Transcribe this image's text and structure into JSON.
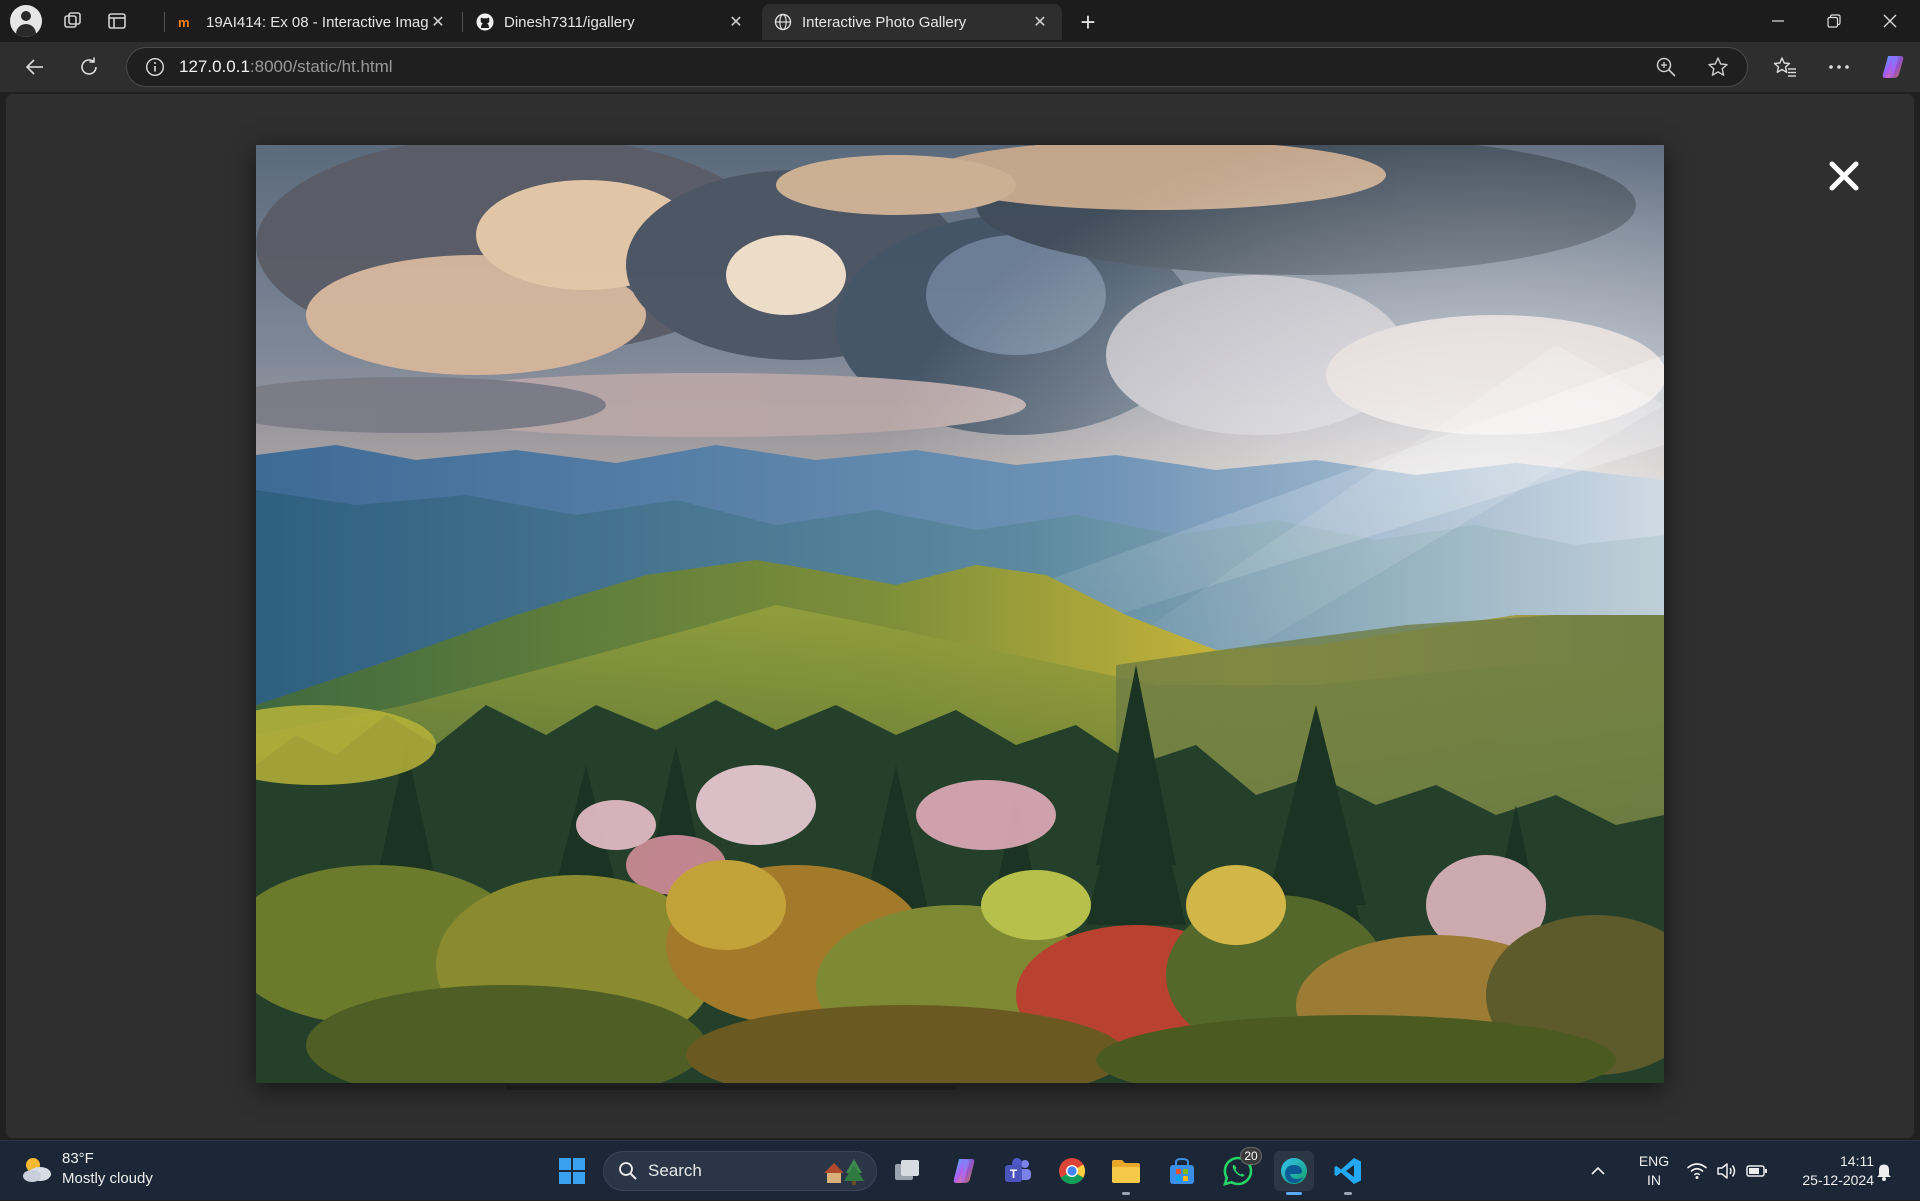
{
  "browser": {
    "tabs": [
      {
        "title": "19AI414: Ex 08 - Interactive Image",
        "favicon": "moodle-icon"
      },
      {
        "title": "Dinesh7311/igallery",
        "favicon": "github-icon"
      },
      {
        "title": "Interactive Photo Gallery",
        "favicon": "globe-icon",
        "active": true
      }
    ],
    "address": {
      "host": "127.0.0.1",
      "rest": ":8000/static/ht.html"
    }
  },
  "gallery": {
    "image_alt": "Mountain landscape at sunrise with clouds, sun rays and blooming trees",
    "close_symbol": "✕"
  },
  "taskbar": {
    "weather": {
      "temp": "83°F",
      "condition": "Mostly cloudy"
    },
    "search_placeholder": "Search",
    "pinned_apps": [
      "windows-start",
      "search",
      "task-view",
      "copilot",
      "teams",
      "chrome",
      "file-explorer",
      "microsoft-store",
      "whatsapp",
      "edge",
      "vscode"
    ],
    "whatsapp_badge": "20",
    "language": {
      "line1": "ENG",
      "line2": "IN"
    },
    "clock": {
      "time": "14:11",
      "date": "25-12-2024"
    }
  },
  "colors": {
    "page_bg": "#2f2f2f",
    "chrome_bg": "#1c1c1c",
    "toolbar_bg": "#2e2e2e",
    "taskbar_bg": "#1b2636"
  }
}
